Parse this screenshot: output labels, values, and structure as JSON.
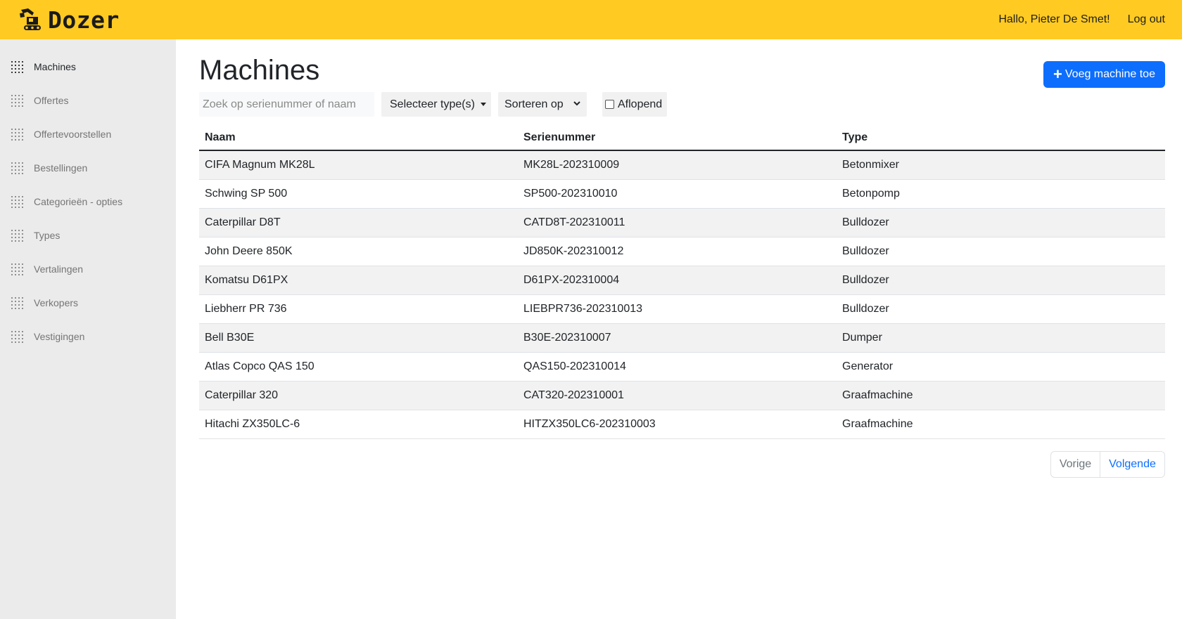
{
  "header": {
    "brand": "Dozer",
    "greeting": "Hallo, Pieter De Smet!",
    "logout": "Log out"
  },
  "sidebar": {
    "items": [
      {
        "label": "Machines",
        "active": true
      },
      {
        "label": "Offertes"
      },
      {
        "label": "Offertevoorstellen"
      },
      {
        "label": "Bestellingen"
      },
      {
        "label": "Categorieën - opties"
      },
      {
        "label": "Types"
      },
      {
        "label": "Vertalingen"
      },
      {
        "label": "Verkopers"
      },
      {
        "label": "Vestigingen"
      }
    ]
  },
  "main": {
    "title": "Machines",
    "add_button": "Voeg machine toe",
    "search_placeholder": "Zoek op serienummer of naam",
    "type_filter": "Selecteer type(s)",
    "sort_label": "Sorteren op",
    "descending_label": "Aflopend",
    "descending_checked": false
  },
  "table": {
    "headers": [
      "Naam",
      "Serienummer",
      "Type"
    ],
    "rows": [
      [
        "CIFA Magnum MK28L",
        "MK28L-202310009",
        "Betonmixer"
      ],
      [
        "Schwing SP 500",
        "SP500-202310010",
        "Betonpomp"
      ],
      [
        "Caterpillar D8T",
        "CATD8T-202310011",
        "Bulldozer"
      ],
      [
        "John Deere 850K",
        "JD850K-202310012",
        "Bulldozer"
      ],
      [
        "Komatsu D61PX",
        "D61PX-202310004",
        "Bulldozer"
      ],
      [
        "Liebherr PR 736",
        "LIEBPR736-202310013",
        "Bulldozer"
      ],
      [
        "Bell B30E",
        "B30E-202310007",
        "Dumper"
      ],
      [
        "Atlas Copco QAS 150",
        "QAS150-202310014",
        "Generator"
      ],
      [
        "Caterpillar 320",
        "CAT320-202310001",
        "Graafmachine"
      ],
      [
        "Hitachi ZX350LC-6",
        "HITZX350LC6-202310003",
        "Graafmachine"
      ]
    ]
  },
  "pagination": {
    "prev": "Vorige",
    "next": "Volgende"
  },
  "colors": {
    "topbar": "#ffca22",
    "sidebar": "#ebebeb",
    "primary": "#0d6efd"
  }
}
